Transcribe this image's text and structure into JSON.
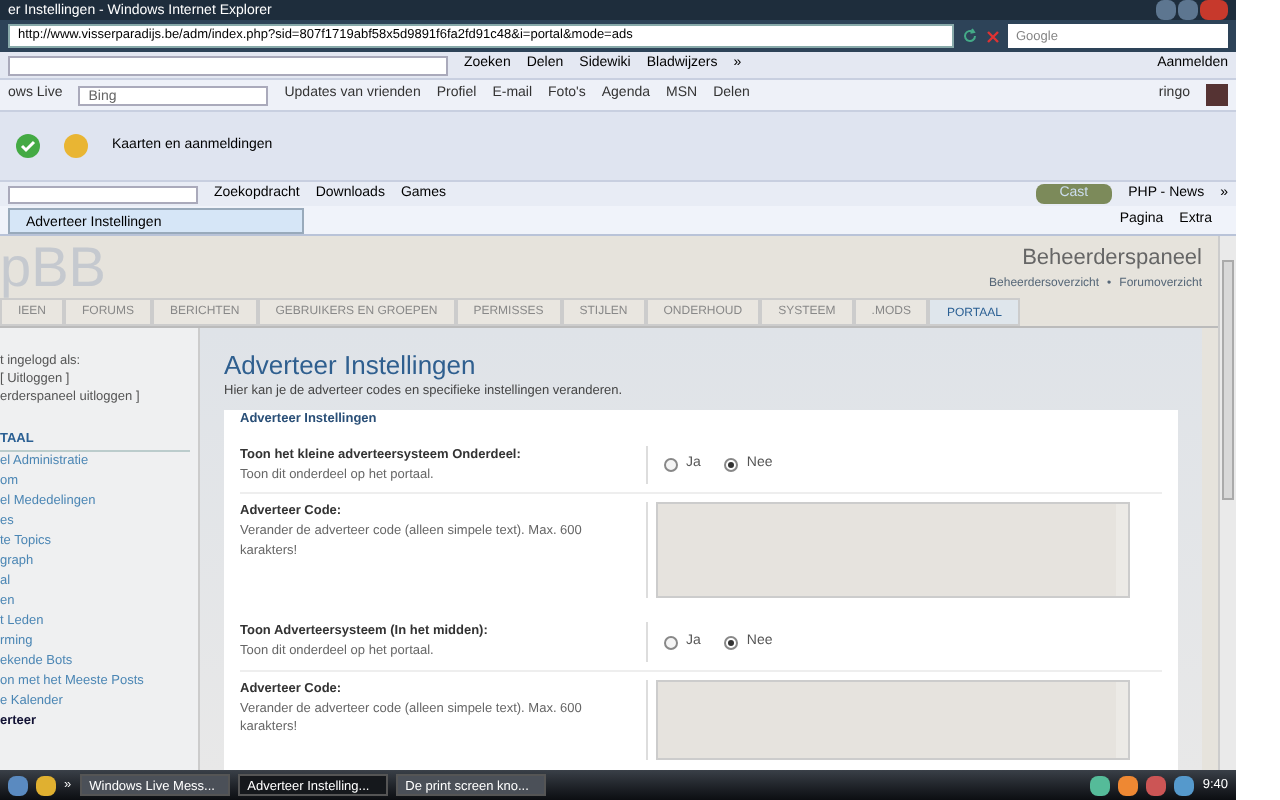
{
  "window": {
    "title": "er Instellingen - Windows Internet Explorer"
  },
  "address_bar": {
    "url": "http://www.visserparadijs.be/adm/index.php?sid=807f1719abf58x5d9891f6fa2fd91c48&i=portal&mode=ads",
    "search_placeholder": "Google"
  },
  "google_toolbar": {
    "items": [
      "Zoeken",
      "Delen",
      "Sidewiki",
      "Bladwijzers",
      "»"
    ],
    "signin": "Aanmelden"
  },
  "live_toolbar": {
    "label": "ows Live",
    "search_value": "Bing",
    "links": [
      "Updates van vrienden",
      "Profiel",
      "E-mail",
      "Foto's",
      "Agenda",
      "MSN",
      "Delen"
    ],
    "user": "ringo"
  },
  "wide_toolbar": {
    "label": "Kaarten en aanmeldingen"
  },
  "links_toolbar": {
    "items": [
      "Zoekopdracht",
      "Downloads",
      "Games"
    ],
    "radio_label": "Cast",
    "news": "PHP - News",
    "more": "»"
  },
  "tabs": [
    {
      "label": "Adverteer Instellingen",
      "selected": true
    }
  ],
  "command_bar": {
    "items": [
      "Pagina",
      "Extra"
    ]
  },
  "page": {
    "logo": "pBB",
    "panel_title": "Beheerderspaneel",
    "panel_links": [
      "Beheerdersoverzicht",
      "Forumoverzicht"
    ],
    "panel_separator": "•",
    "nav_tabs": [
      {
        "label": "IEEN",
        "selected": false
      },
      {
        "label": "FORUMS",
        "selected": false
      },
      {
        "label": "BERICHTEN",
        "selected": false
      },
      {
        "label": "GEBRUIKERS EN GROEPEN",
        "selected": false
      },
      {
        "label": "PERMISSES",
        "selected": false
      },
      {
        "label": "STIJLEN",
        "selected": false
      },
      {
        "label": "ONDERHOUD",
        "selected": false
      },
      {
        "label": "SYSTEEM",
        "selected": false
      },
      {
        "label": ".MODS",
        "selected": false
      },
      {
        "label": "PORTAAL",
        "selected": true
      }
    ],
    "sidebar": {
      "login_lines": [
        "t ingelogd als:",
        "[ Uitloggen ]",
        "erderspaneel uitloggen ]"
      ],
      "heading": "TAAL",
      "items": [
        {
          "label": "el Administratie",
          "selected": false
        },
        {
          "label": "om",
          "selected": false
        },
        {
          "label": "el Mededelingen",
          "selected": false
        },
        {
          "label": "es",
          "selected": false
        },
        {
          "label": "te Topics",
          "selected": false
        },
        {
          "label": "graph",
          "selected": false
        },
        {
          "label": "al",
          "selected": false
        },
        {
          "label": "en",
          "selected": false
        },
        {
          "label": "t Leden",
          "selected": false
        },
        {
          "label": "rming",
          "selected": false
        },
        {
          "label": "ekende Bots",
          "selected": false
        },
        {
          "label": "on met het Meeste Posts",
          "selected": false
        },
        {
          "label": "e Kalender",
          "selected": false
        },
        {
          "label": "erteer",
          "selected": true
        }
      ]
    },
    "title": "Adverteer Instellingen",
    "description": "Hier kan je de adverteer codes en specifieke instellingen veranderen.",
    "legend": "Adverteer Instellingen",
    "settings": [
      {
        "label": "Toon het kleine adverteersysteem Onderdeel:",
        "hint": "Toon dit onderdeel op het portaal.",
        "options": [
          {
            "label": "Ja",
            "selected": false
          },
          {
            "label": "Nee",
            "selected": true
          }
        ],
        "code_label": "Adverteer Code:",
        "code_hint": "Verander de adverteer code (alleen simpele text). Max. 600 karakters!"
      },
      {
        "label": "Toon Adverteersysteem (In het midden):",
        "hint": "Toon dit onderdeel op het portaal.",
        "options": [
          {
            "label": "Ja",
            "selected": false
          },
          {
            "label": "Nee",
            "selected": true
          }
        ],
        "code_label": "Adverteer Code:",
        "code_hint": "Verander de adverteer code (alleen simpele text). Max. 600 karakters!"
      }
    ]
  },
  "taskbar": {
    "buttons": [
      {
        "label": "Windows Live Mess...",
        "selected": false
      },
      {
        "label": "Adverteer Instelling...",
        "selected": true
      },
      {
        "label": "De print screen kno...",
        "selected": false
      }
    ],
    "more": "»",
    "clock": "9:40"
  }
}
